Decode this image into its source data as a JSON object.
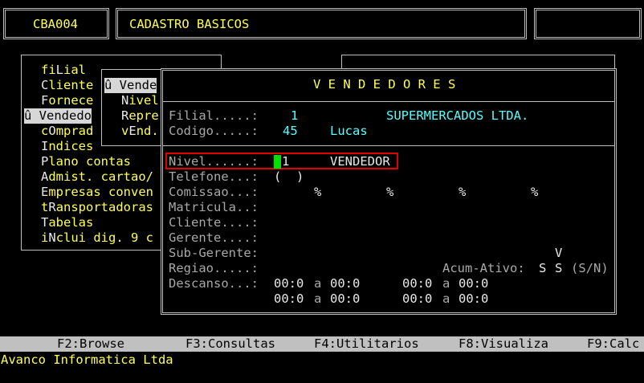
{
  "header": {
    "program_code": "CBA004",
    "title": "CADASTRO BASICOS"
  },
  "menu": {
    "items": [
      {
        "pre": "fi",
        "hot": "L",
        "post": "ial",
        "active": false
      },
      {
        "pre": "",
        "hot": "C",
        "post": "liente",
        "active": false
      },
      {
        "pre": "",
        "hot": "F",
        "post": "ornece",
        "active": false
      },
      {
        "pre": "û ",
        "hot": "V",
        "post": "endedo",
        "active": true
      },
      {
        "pre": "c",
        "hot": "O",
        "post": "mprad",
        "active": false
      },
      {
        "pre": "",
        "hot": "I",
        "post": "ndices",
        "active": false
      },
      {
        "pre": "",
        "hot": "P",
        "post": "lano contas",
        "active": false
      },
      {
        "pre": "",
        "hot": "A",
        "post": "dmist. cartao/",
        "active": false
      },
      {
        "pre": "",
        "hot": "E",
        "post": "mpresas conven",
        "active": false
      },
      {
        "pre": "t",
        "hot": "R",
        "post": "ansportadoras",
        "active": false
      },
      {
        "pre": "",
        "hot": "T",
        "post": "abelas",
        "active": false
      },
      {
        "pre": "i",
        "hot": "N",
        "post": "clui dig. 9 c",
        "active": false
      }
    ]
  },
  "submenu": {
    "items": [
      {
        "pre": "û ",
        "hot": "V",
        "post": "ende",
        "active": true
      },
      {
        "pre": "",
        "hot": "N",
        "post": "ivel",
        "active": false
      },
      {
        "pre": "",
        "hot": "R",
        "post": "epre",
        "active": false
      },
      {
        "pre": "v",
        "hot": "E",
        "post": "nd.",
        "active": false
      }
    ]
  },
  "form": {
    "title": "V E N D E D O R E S",
    "filial_label": "Filial.....:",
    "filial_code": "1",
    "filial_name": "SUPERMERCADOS LTDA.",
    "codigo_label": "Codigo.....:",
    "codigo_value": "45",
    "codigo_name": "Lucas",
    "nivel_label": "Nivel......:",
    "nivel_value": "1",
    "nivel_desc": "VENDEDOR",
    "telefone_label": "Telefone...:",
    "telefone_value": "(  )",
    "comissao_label": "Comissao...:",
    "comissao_pcts": [
      "%",
      "%",
      "%",
      "%"
    ],
    "matricula_label": "Matricula..:",
    "cliente_label": "Cliente....:",
    "gerente_label": "Gerente....:",
    "subgerente_label": "Sub-Gerente:",
    "subgerente_value": "V",
    "regiao_label": "Regiao.....:",
    "acum_label": "Acum-Ativo:",
    "acum_value1": "S",
    "acum_value2": "S",
    "acum_hint": "(S/N)",
    "descanso_label": "Descanso...:",
    "descanso_rows": [
      {
        "t1": "00:0",
        "a1": "a",
        "t2": "00:0",
        "t3": "00:0",
        "a2": "a",
        "t4": "00:0"
      },
      {
        "t1": "00:0",
        "a1": "a",
        "t2": "00:0",
        "t3": "00:0",
        "a2": "a",
        "t4": "00:0"
      }
    ]
  },
  "function_keys": [
    {
      "key": "F2:",
      "label": "Browse"
    },
    {
      "key": "F3:",
      "label": "Consultas"
    },
    {
      "key": "F4:",
      "label": "Utilitarios"
    },
    {
      "key": "F8:",
      "label": "Visualiza"
    },
    {
      "key": "F9:",
      "label": "Calc"
    }
  ],
  "footer": {
    "company": "Avanco Informatica Ltda"
  },
  "colors": {
    "background": "#000000",
    "label": "#a8a8a8",
    "highlight_text": "#ffff55",
    "value": "#55ffff",
    "cursor": "#00e000",
    "focus_border": "#e00000"
  }
}
